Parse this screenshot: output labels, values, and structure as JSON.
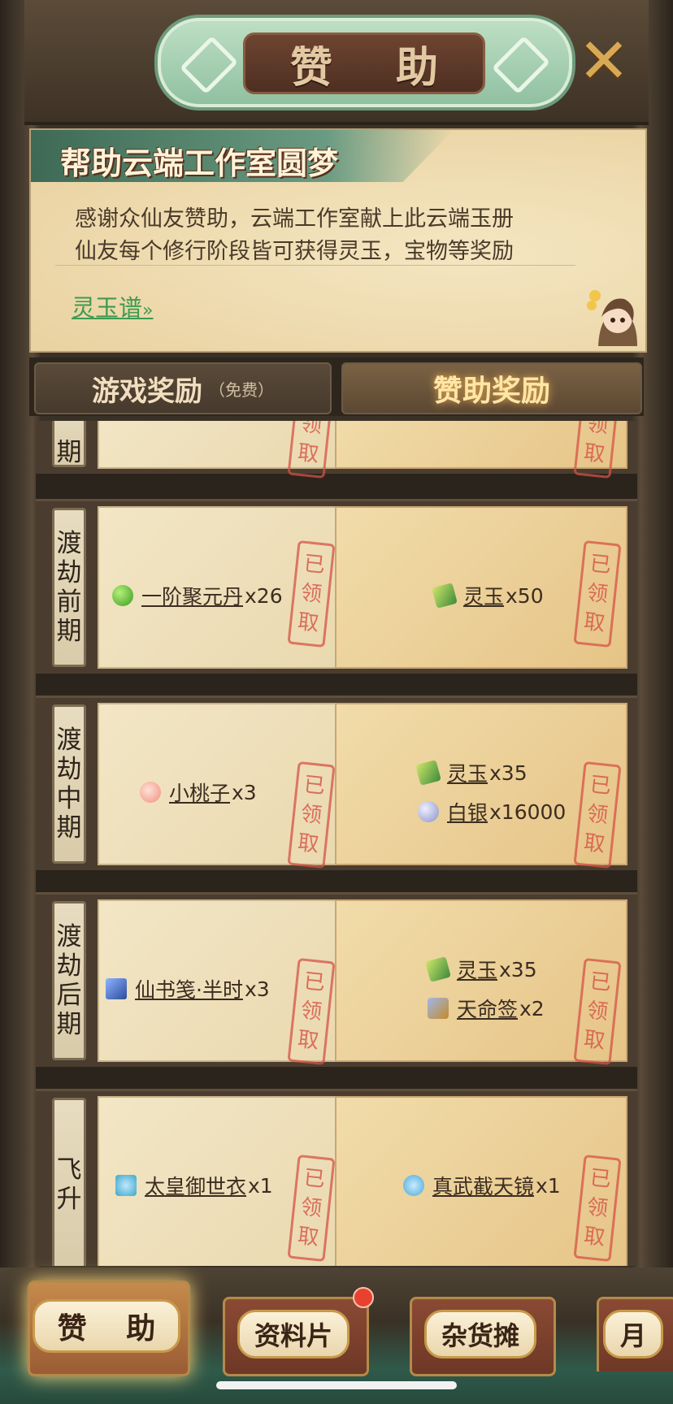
{
  "header": {
    "title": "赞 助",
    "close_icon": "close-icon"
  },
  "banner": {
    "title": "帮助云端工作室圆梦",
    "line1": "感谢众仙友赞助，云端工作室献上此云端玉册",
    "line2": "仙友每个修行阶段皆可获得灵玉，宝物等奖励",
    "link_label": "灵玉谱",
    "link_arrow": "»"
  },
  "tabs": {
    "free": "游戏奖励",
    "free_note": "（免费）",
    "sponsor": "赞助奖励"
  },
  "stamp": {
    "c1": "已",
    "c2": "领",
    "c3": "取"
  },
  "rows": [
    {
      "label": [
        "期"
      ],
      "free": [],
      "paid": []
    },
    {
      "label": [
        "渡",
        "劫",
        "前",
        "期"
      ],
      "free": [
        {
          "name": "一阶聚元丹",
          "count": "x26",
          "icon": "green-pill-icon"
        }
      ],
      "paid": [
        {
          "name": "灵玉",
          "count": "x50",
          "icon": "jade-icon"
        }
      ]
    },
    {
      "label": [
        "渡",
        "劫",
        "中",
        "期"
      ],
      "free": [
        {
          "name": "小桃子",
          "count": "x3",
          "icon": "peach-icon"
        }
      ],
      "paid": [
        {
          "name": "灵玉",
          "count": "x35",
          "icon": "jade-icon"
        },
        {
          "name": "白银",
          "count": "x16000",
          "icon": "silver-coin-icon"
        }
      ]
    },
    {
      "label": [
        "渡",
        "劫",
        "后",
        "期"
      ],
      "free": [
        {
          "name": "仙书笺·半时",
          "count": "x3",
          "icon": "book-icon"
        }
      ],
      "paid": [
        {
          "name": "灵玉",
          "count": "x35",
          "icon": "jade-icon"
        },
        {
          "name": "天命签",
          "count": "x2",
          "icon": "fate-sign-icon"
        }
      ]
    },
    {
      "label": [
        "飞",
        "升"
      ],
      "free": [
        {
          "name": "太皇御世衣",
          "count": "x1",
          "icon": "robe-icon"
        }
      ],
      "paid": [
        {
          "name": "真武截天镜",
          "count": "x1",
          "icon": "mirror-icon"
        }
      ]
    }
  ],
  "bottom_tabs": [
    "赞 助",
    "资料片",
    "杂货摊",
    "月"
  ],
  "colors": {
    "accent": "#d8a954",
    "stamp": "#d65246",
    "link": "#3f9a52"
  }
}
